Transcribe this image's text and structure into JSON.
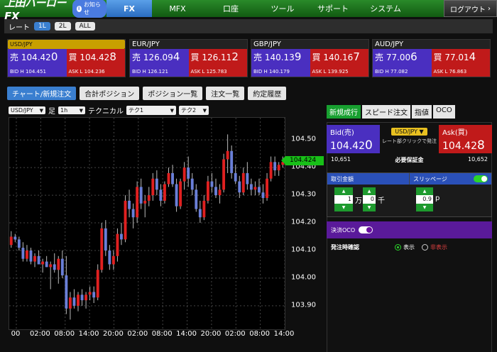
{
  "header": {
    "logo": "上田ハーローFX",
    "notice": "お知らせ",
    "nav": [
      "FX",
      "MFX",
      "口座",
      "ツール",
      "サポート",
      "システム"
    ],
    "active_nav": "FX",
    "logout": "ログアウト"
  },
  "rate_bar": {
    "label": "レート",
    "options": [
      "1L",
      "2L",
      "ALL"
    ],
    "active": "1L"
  },
  "currencies": [
    {
      "pair": "USD/JPY",
      "selected": true,
      "bid_pre": "売 104.42",
      "bid_big": "0",
      "ask_pre": "買 104.42",
      "ask_big": "8",
      "bid_hl": "BID H 104.451",
      "ask_hl": "ASK L 104.236"
    },
    {
      "pair": "EUR/JPY",
      "selected": false,
      "bid_pre": "売 126.09",
      "bid_big": "4",
      "ask_pre": "買 126.11",
      "ask_big": "2",
      "bid_hl": "BID H 126.121",
      "ask_hl": "ASK L 125.783"
    },
    {
      "pair": "GBP/JPY",
      "selected": false,
      "bid_pre": "売 140.13",
      "bid_big": "9",
      "ask_pre": "買 140.16",
      "ask_big": "7",
      "bid_hl": "BID H 140.179",
      "ask_hl": "ASK L 139.925"
    },
    {
      "pair": "AUD/JPY",
      "selected": false,
      "bid_pre": "売 77.00",
      "bid_big": "6",
      "ask_pre": "買 77.01",
      "ask_big": "4",
      "bid_hl": "BID H 77.082",
      "ask_hl": "ASK L 76.863"
    }
  ],
  "tabs": [
    "チャート/新規注文",
    "合計ポジション",
    "ポジション一覧",
    "注文一覧",
    "約定履歴"
  ],
  "active_tab": "チャート/新規注文",
  "chart_ctrl": {
    "pair": "USD/JPY",
    "foot_label": "足",
    "timeframe": "1h",
    "technical_label": "テクニカル",
    "tech1": "テク1",
    "tech2": "テク2"
  },
  "chart_data": {
    "type": "candlestick",
    "y_ticks": [
      "104.50",
      "104.40",
      "104.30",
      "104.20",
      "104.10",
      "104.00",
      "103.90"
    ],
    "y_tick_values": [
      104.5,
      104.4,
      104.3,
      104.2,
      104.1,
      104.0,
      103.9
    ],
    "ylim": [
      103.815,
      104.58
    ],
    "x_ticks": [
      "00",
      "02:00",
      "08:00",
      "14:00",
      "20:00",
      "02:00",
      "08:00",
      "14:00",
      "20:00",
      "02:00",
      "08:00",
      "14:00"
    ],
    "current_price": "104.424",
    "current_value": 104.424,
    "up_color": "#e02020",
    "down_color": "#6a7fd8",
    "candles": [
      [
        104.12,
        104.17,
        104.11,
        104.15
      ],
      [
        104.15,
        104.16,
        104.13,
        104.14
      ],
      [
        104.14,
        104.15,
        104.1,
        104.11
      ],
      [
        104.11,
        104.13,
        104.06,
        104.07
      ],
      [
        104.07,
        104.12,
        104.06,
        104.1
      ],
      [
        104.1,
        104.11,
        104.05,
        104.06
      ],
      [
        104.06,
        104.09,
        104.04,
        104.08
      ],
      [
        104.08,
        104.1,
        104.05,
        104.05
      ],
      [
        104.05,
        104.07,
        104.02,
        104.06
      ],
      [
        104.06,
        104.08,
        104.04,
        104.04
      ],
      [
        104.04,
        104.06,
        103.96,
        104.05
      ],
      [
        104.05,
        104.09,
        104.02,
        104.03
      ],
      [
        104.03,
        104.08,
        103.98,
        104.07
      ],
      [
        104.07,
        104.1,
        104.0,
        104.01
      ],
      [
        104.01,
        104.08,
        103.87,
        103.89
      ],
      [
        103.89,
        103.95,
        103.85,
        103.93
      ],
      [
        103.93,
        103.96,
        103.89,
        103.9
      ],
      [
        103.9,
        103.95,
        103.88,
        103.94
      ],
      [
        103.94,
        103.96,
        103.9,
        103.92
      ],
      [
        103.92,
        103.95,
        103.89,
        103.94
      ],
      [
        103.94,
        103.97,
        103.92,
        103.95
      ],
      [
        103.95,
        103.97,
        103.91,
        103.93
      ],
      [
        103.93,
        104.05,
        103.92,
        104.03
      ],
      [
        104.03,
        104.2,
        104.02,
        104.18
      ],
      [
        104.18,
        104.21,
        104.08,
        104.1
      ],
      [
        104.1,
        104.12,
        104.03,
        104.05
      ],
      [
        104.05,
        104.1,
        104.03,
        104.08
      ],
      [
        104.08,
        104.18,
        104.06,
        104.16
      ],
      [
        104.16,
        104.2,
        104.12,
        104.14
      ],
      [
        104.14,
        104.3,
        104.13,
        104.28
      ],
      [
        104.28,
        104.32,
        104.22,
        104.25
      ],
      [
        104.25,
        104.27,
        104.18,
        104.22
      ],
      [
        104.22,
        104.35,
        104.2,
        104.33
      ],
      [
        104.33,
        104.36,
        104.25,
        104.27
      ],
      [
        104.27,
        104.3,
        104.22,
        104.28
      ],
      [
        104.28,
        104.33,
        104.26,
        104.3
      ],
      [
        104.3,
        104.38,
        104.28,
        104.36
      ],
      [
        104.36,
        104.39,
        104.3,
        104.32
      ],
      [
        104.32,
        104.34,
        104.26,
        104.28
      ],
      [
        104.28,
        104.35,
        104.27,
        104.34
      ],
      [
        104.34,
        104.4,
        104.33,
        104.38
      ],
      [
        104.38,
        104.41,
        104.33,
        104.34
      ],
      [
        104.34,
        104.36,
        104.24,
        104.26
      ],
      [
        104.26,
        104.36,
        104.25,
        104.35
      ],
      [
        104.35,
        104.42,
        104.32,
        104.4
      ],
      [
        104.4,
        104.44,
        104.33,
        104.36
      ],
      [
        104.36,
        104.38,
        104.3,
        104.32
      ],
      [
        104.32,
        104.34,
        104.24,
        104.25
      ],
      [
        104.25,
        104.28,
        104.2,
        104.22
      ],
      [
        104.22,
        104.3,
        104.21,
        104.28
      ],
      [
        104.28,
        104.37,
        104.27,
        104.35
      ],
      [
        104.35,
        104.38,
        104.31,
        104.33
      ],
      [
        104.33,
        104.36,
        104.29,
        104.3
      ],
      [
        104.3,
        104.34,
        104.27,
        104.32
      ],
      [
        104.32,
        104.45,
        104.31,
        104.43
      ],
      [
        104.43,
        104.52,
        104.38,
        104.46
      ],
      [
        104.46,
        104.48,
        104.36,
        104.38
      ],
      [
        104.38,
        104.41,
        104.34,
        104.35
      ],
      [
        104.35,
        104.37,
        104.29,
        104.31
      ],
      [
        104.31,
        104.4,
        104.3,
        104.38
      ],
      [
        104.38,
        104.42,
        104.32,
        104.34
      ],
      [
        104.34,
        104.36,
        104.3,
        104.32
      ],
      [
        104.32,
        104.35,
        104.3,
        104.33
      ],
      [
        104.33,
        104.36,
        104.3,
        104.31
      ],
      [
        104.31,
        104.34,
        104.27,
        104.29
      ],
      [
        104.29,
        104.38,
        104.28,
        104.36
      ],
      [
        104.36,
        104.44,
        104.35,
        104.42
      ],
      [
        104.42,
        104.44,
        104.37,
        104.39
      ],
      [
        104.39,
        104.42,
        104.37,
        104.41
      ],
      [
        104.41,
        104.44,
        104.4,
        104.42
      ]
    ]
  },
  "order": {
    "tabs": [
      "新規成行",
      "スピード注文",
      "指値",
      "OCO"
    ],
    "active_tab": "新規成行",
    "bid_label": "Bid(売)",
    "bid_pre": "104.42",
    "bid_big": "0",
    "ask_label": "Ask(買)",
    "ask_pre": "104.42",
    "ask_big": "8",
    "pair": "USD/JPY",
    "pair_note": "レート部クリックで発注",
    "bid_margin": "10,651",
    "margin_label": "必要保証金",
    "ask_margin": "10,652",
    "qty_label": "取引金額",
    "slippage_label": "スリッページ",
    "qty_man": "1",
    "qty_man_unit": "万",
    "qty_sen": "0",
    "qty_sen_unit": "千",
    "slip_val": "0.9",
    "slip_unit": "p",
    "oco_label": "決済OCO",
    "confirm_label": "発注時確認",
    "confirm_show": "表示",
    "confirm_hide": "非表示"
  }
}
